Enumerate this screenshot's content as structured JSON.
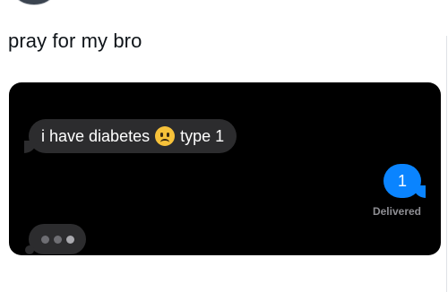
{
  "post": {
    "text": "pray for my bro"
  },
  "conversation": {
    "incoming": {
      "text_before": "i have diabetes",
      "emoji": "slightly-frowning-face",
      "text_after": "type 1"
    },
    "outgoing": {
      "text": "1",
      "status": "Delivered"
    },
    "typing_indicator": {
      "dots": 3
    }
  },
  "colors": {
    "incoming_bubble": "#2c2c2e",
    "outgoing_bubble": "#0a84ff",
    "media_background": "#000000",
    "status_text": "#8e8e93"
  }
}
